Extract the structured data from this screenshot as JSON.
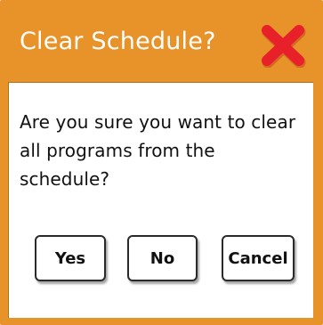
{
  "dialog": {
    "title": "Clear Schedule?",
    "close_icon": "close-x-icon",
    "message": "Are you sure you want to clear all programs from the schedule?",
    "buttons": {
      "yes": "Yes",
      "no": "No",
      "cancel": "Cancel"
    }
  },
  "colors": {
    "titlebar": "#e8922a",
    "close_icon": "#e8202a",
    "content_background": "#ffffff",
    "button_border": "#2a2a2a"
  }
}
